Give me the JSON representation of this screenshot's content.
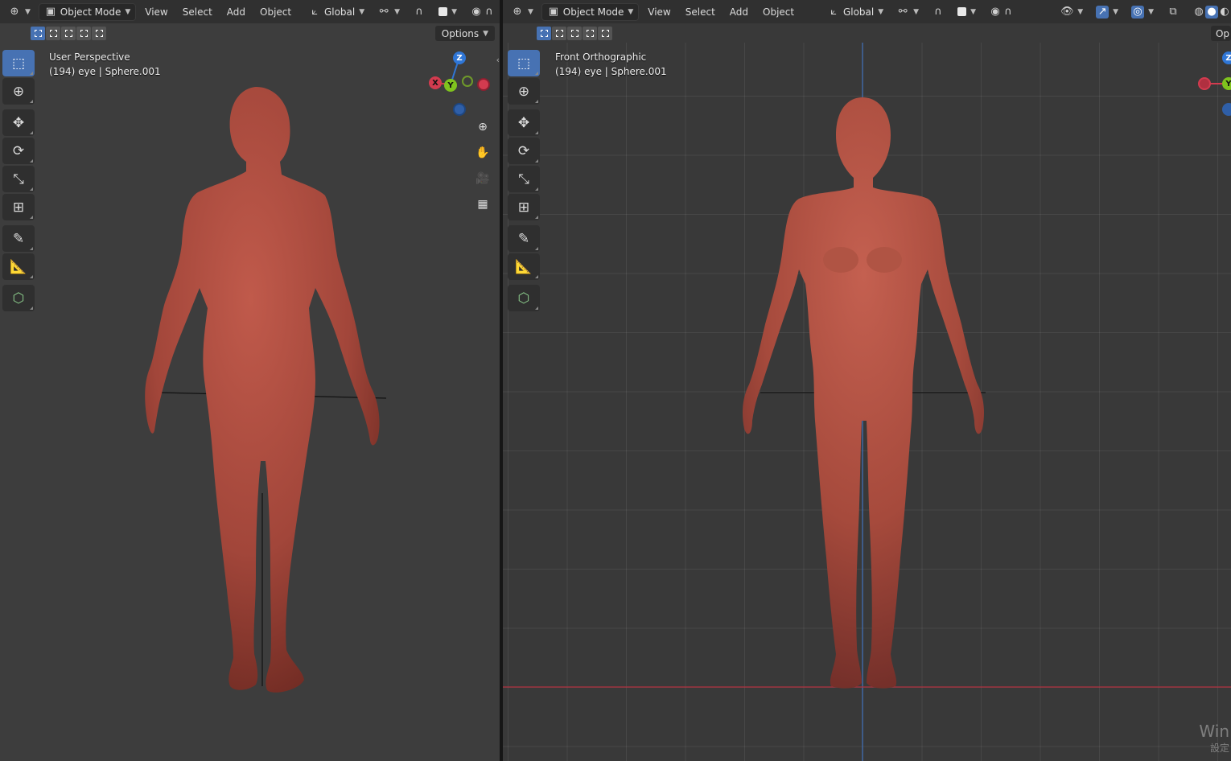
{
  "left_viewport": {
    "header": {
      "mode_label": "Object Mode",
      "menu": [
        "View",
        "Select",
        "Add",
        "Object"
      ],
      "transform_orientation": "Global"
    },
    "options_label": "Options",
    "view_name": "User Perspective",
    "object_info": "(194) eye | Sphere.001",
    "gizmo": {
      "z": "Z",
      "x": "X",
      "y": "Y"
    }
  },
  "right_viewport": {
    "header": {
      "mode_label": "Object Mode",
      "menu": [
        "View",
        "Select",
        "Add",
        "Object"
      ],
      "transform_orientation": "Global"
    },
    "options_label": "Op",
    "view_name": "Front Orthographic",
    "object_info": "(194) eye | Sphere.001",
    "gizmo": {
      "z": "Z",
      "y": "Y"
    }
  },
  "watermark": {
    "line1": "Win",
    "line2": "設定"
  },
  "colors": {
    "accent": "#4772b3",
    "skin": "#a9483b",
    "axis_x": "#d33b4f",
    "axis_y": "#7fc21e",
    "axis_z": "#2f76d6"
  },
  "icons": {
    "tools": [
      "select-box-icon",
      "cursor-icon",
      "move-icon",
      "rotate-icon",
      "scale-icon",
      "transform-icon",
      "annotate-icon",
      "measure-icon",
      "add-cube-icon"
    ],
    "nav": [
      "zoom-icon",
      "hand-icon",
      "camera-icon",
      "grid-icon"
    ]
  }
}
